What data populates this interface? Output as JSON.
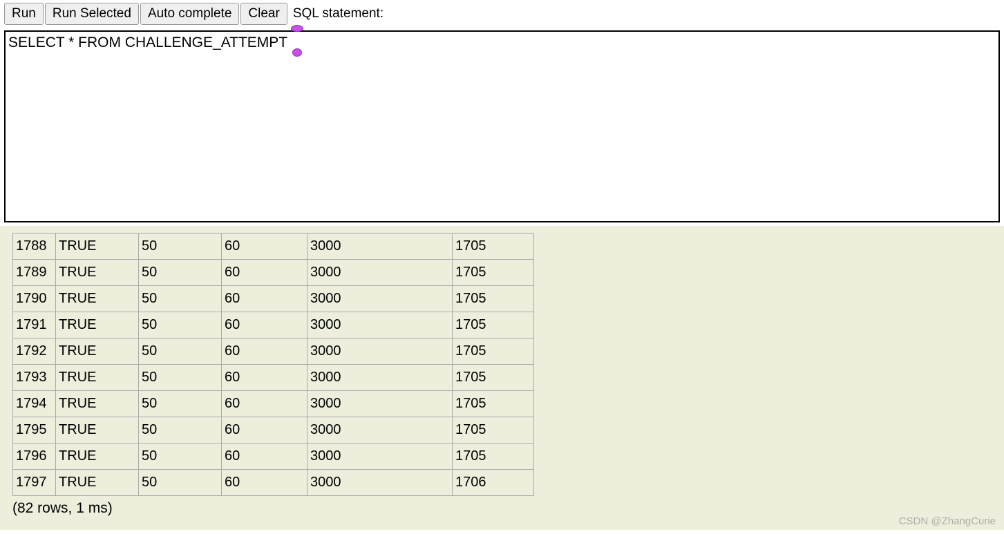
{
  "toolbar": {
    "run_label": "Run",
    "run_selected_label": "Run Selected",
    "auto_complete_label": "Auto complete",
    "clear_label": "Clear",
    "sql_statement_label": "SQL statement:"
  },
  "editor": {
    "value": "SELECT * FROM CHALLENGE_ATTEMPT"
  },
  "results": {
    "rows": [
      {
        "c0": "1788",
        "c1": "TRUE",
        "c2": "50",
        "c3": "60",
        "c4": "3000",
        "c5": "1705"
      },
      {
        "c0": "1789",
        "c1": "TRUE",
        "c2": "50",
        "c3": "60",
        "c4": "3000",
        "c5": "1705"
      },
      {
        "c0": "1790",
        "c1": "TRUE",
        "c2": "50",
        "c3": "60",
        "c4": "3000",
        "c5": "1705"
      },
      {
        "c0": "1791",
        "c1": "TRUE",
        "c2": "50",
        "c3": "60",
        "c4": "3000",
        "c5": "1705"
      },
      {
        "c0": "1792",
        "c1": "TRUE",
        "c2": "50",
        "c3": "60",
        "c4": "3000",
        "c5": "1705"
      },
      {
        "c0": "1793",
        "c1": "TRUE",
        "c2": "50",
        "c3": "60",
        "c4": "3000",
        "c5": "1705"
      },
      {
        "c0": "1794",
        "c1": "TRUE",
        "c2": "50",
        "c3": "60",
        "c4": "3000",
        "c5": "1705"
      },
      {
        "c0": "1795",
        "c1": "TRUE",
        "c2": "50",
        "c3": "60",
        "c4": "3000",
        "c5": "1705"
      },
      {
        "c0": "1796",
        "c1": "TRUE",
        "c2": "50",
        "c3": "60",
        "c4": "3000",
        "c5": "1705"
      },
      {
        "c0": "1797",
        "c1": "TRUE",
        "c2": "50",
        "c3": "60",
        "c4": "3000",
        "c5": "1706"
      }
    ],
    "status": "(82 rows, 1 ms)"
  },
  "watermark": "CSDN @ZhangCurie"
}
